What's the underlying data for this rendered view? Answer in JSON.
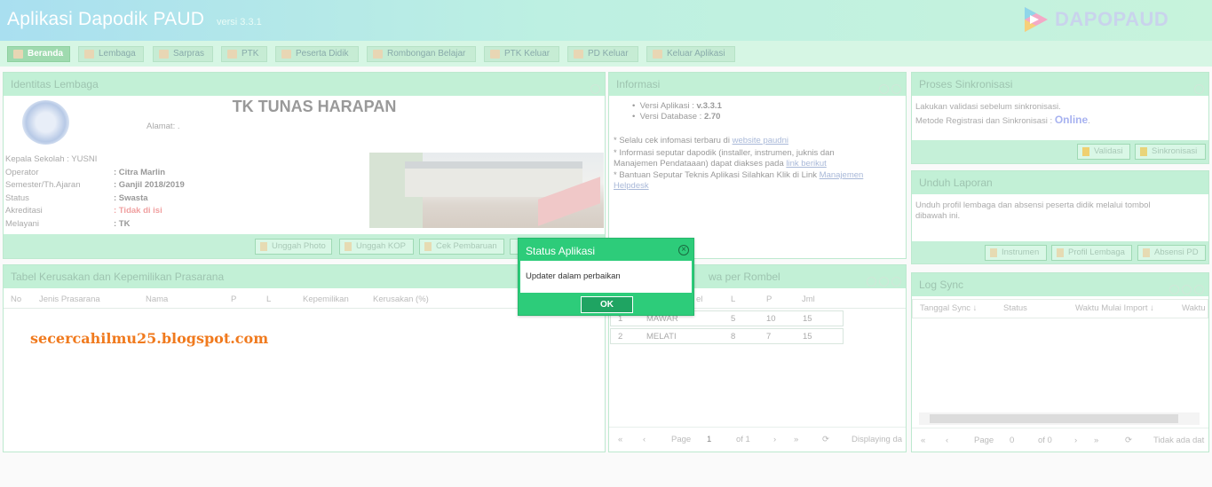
{
  "header": {
    "title": "Aplikasi Dapodik PAUD",
    "version": "versi 3.3.1",
    "logo_text": "DAPOPAUD"
  },
  "nav": [
    "Beranda",
    "Lembaga",
    "Sarpras",
    "PTK",
    "Peserta Didik",
    "Rombongan Belajar",
    "PTK Keluar",
    "PD Keluar",
    "Keluar Aplikasi"
  ],
  "identitas": {
    "title": "Identitas Lembaga",
    "school": "TK TUNAS HARAPAN",
    "alamat_label": "Alamat: .",
    "kepala": "Kepala Sekolah : YUSNI",
    "rows": [
      {
        "k": "Operator",
        "v": ": Citra Marlin"
      },
      {
        "k": "Semester/Th.Ajaran",
        "v": ": Ganjil 2018/2019"
      },
      {
        "k": "Status",
        "v": ": Swasta"
      },
      {
        "k": "Akreditasi",
        "v": ": Tidak di isi"
      },
      {
        "k": "Melayani",
        "v": ": TK"
      }
    ],
    "buttons": [
      "Unggah Photo",
      "Unggah KOP",
      "Cek Pembaruan"
    ]
  },
  "kerusakan": {
    "title": "Tabel Kerusakan dan Kepemilikan Prasarana",
    "cols": [
      "No",
      "Jenis Prasarana",
      "Nama",
      "P",
      "L",
      "Kepemilikan",
      "Kerusakan (%)"
    ]
  },
  "watermark": "secercahilmu25.blogspot.com",
  "informasi": {
    "title": "Informasi",
    "versi_app_label": "Versi Aplikasi : ",
    "versi_app": "v.3.3.1",
    "versi_db_label": "Versi Database : ",
    "versi_db": "2.70",
    "note1a": "* Selalu cek infomasi terbaru di ",
    "note1_link": "website paudni",
    "note2a": "* Informasi seputar dapodik (installer, instrumen, juknis dan",
    "note2b": "Manajemen Pendataaan) dapat diakses pada ",
    "note2_link": "link berikut",
    "note3a": "* Bantuan Seputar Teknis Aplikasi Silahkan Klik di Link ",
    "note3_link1": "Manajemen",
    "note3_link2": "Helpdesk"
  },
  "rombel": {
    "title": "wa per Rombel",
    "cols": [
      "el",
      "L",
      "P",
      "Jml"
    ],
    "rows": [
      [
        "1",
        "MAWAR",
        "5",
        "10",
        "15"
      ],
      [
        "2",
        "MELATI",
        "8",
        "7",
        "15"
      ]
    ],
    "pager": {
      "page": "Page",
      "num": "1",
      "of": "of 1",
      "disp": "Displaying da"
    }
  },
  "sinkron": {
    "title": "Proses Sinkronisasi",
    "line1": "Lakukan validasi sebelum sinkronisasi.",
    "line2": "Metode Registrasi dan Sinkronisasi : ",
    "status": "Online",
    "dot": ".",
    "btns": [
      "Validasi",
      "Sinkronisasi"
    ]
  },
  "unduh": {
    "title": "Unduh Laporan",
    "text1": "Unduh profil lembaga dan absensi peserta didik melalui tombol",
    "text2": "dibawah ini.",
    "btns": [
      "Instrumen",
      "Profil Lembaga",
      "Absensi PD"
    ]
  },
  "log": {
    "title": "Log Sync",
    "cols": [
      "Tanggal Sync ↓",
      "Status",
      "Waktu Mulai Import ↓",
      "Waktu"
    ],
    "pager": {
      "page": "Page",
      "num": "0",
      "of": "of 0",
      "disp": "Tidak ada dat"
    }
  },
  "modal": {
    "title": "Status Aplikasi",
    "message": "Updater dalam perbaikan",
    "ok": "OK"
  }
}
